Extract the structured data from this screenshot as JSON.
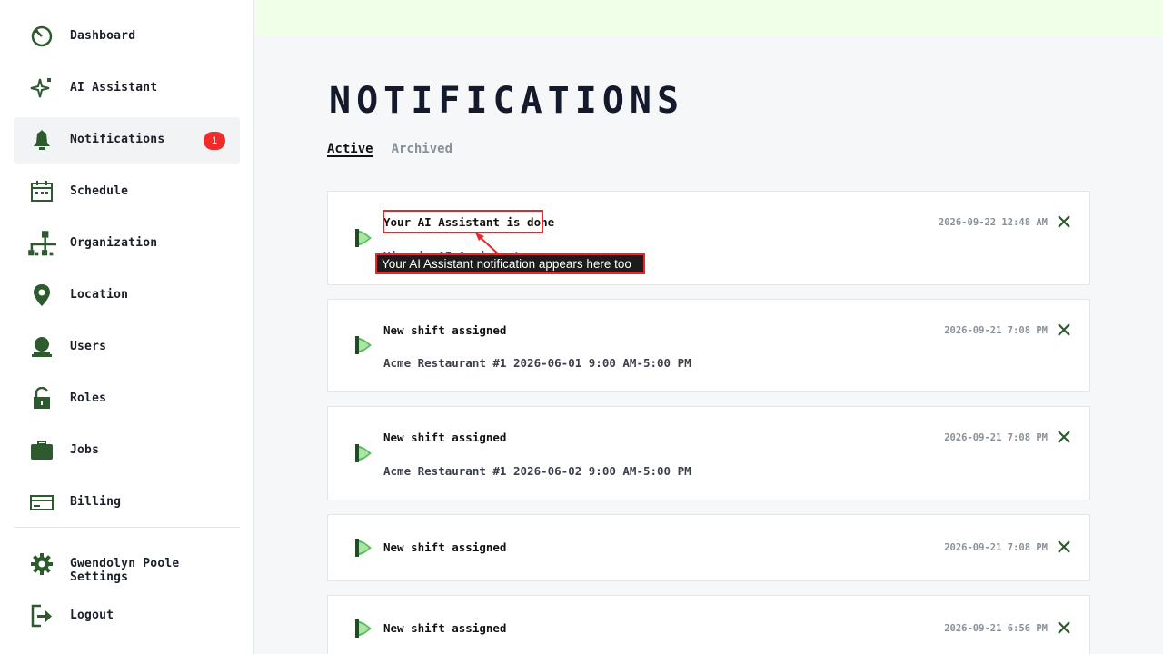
{
  "sidebar": {
    "items": [
      {
        "label": "Dashboard",
        "icon": "dashboard-gauge-icon"
      },
      {
        "label": "AI Assistant",
        "icon": "sparkle-icon"
      },
      {
        "label": "Notifications",
        "icon": "bell-icon",
        "badge": "1",
        "active": true
      },
      {
        "label": "Schedule",
        "icon": "calendar-icon"
      },
      {
        "label": "Organization",
        "icon": "org-chart-icon"
      },
      {
        "label": "Location",
        "icon": "map-pin-icon"
      },
      {
        "label": "Users",
        "icon": "user-icon"
      },
      {
        "label": "Roles",
        "icon": "unlock-icon"
      },
      {
        "label": "Jobs",
        "icon": "briefcase-icon"
      },
      {
        "label": "Billing",
        "icon": "credit-card-icon"
      },
      {
        "label": "Gwendolyn Poole Settings",
        "icon": "gear-icon"
      },
      {
        "label": "Logout",
        "icon": "logout-icon"
      }
    ]
  },
  "page": {
    "title": "NOTIFICATIONS",
    "tabs": [
      {
        "label": "Active",
        "active": true
      },
      {
        "label": "Archived",
        "active": false
      }
    ]
  },
  "notifications": [
    {
      "title": "Your AI Assistant is done",
      "subtitle": "View in AI Assistant",
      "time": "2026-09-22 12:48 AM"
    },
    {
      "title": "New shift assigned",
      "subtitle": "Acme Restaurant #1  2026-06-01  9:00 AM-5:00 PM",
      "time": "2026-09-21 7:08 PM"
    },
    {
      "title": "New shift assigned",
      "subtitle": "Acme Restaurant #1  2026-06-02  9:00 AM-5:00 PM",
      "time": "2026-09-21 7:08 PM"
    },
    {
      "title": "New shift assigned",
      "subtitle": "",
      "time": "2026-09-21 7:08 PM"
    },
    {
      "title": "New shift assigned",
      "subtitle": "",
      "time": "2026-09-21 6:56 PM"
    }
  ],
  "annotation": {
    "callout_text": "Your AI Assistant notification appears here too"
  },
  "colors": {
    "icon_green": "#2d5a2e",
    "badge_red": "#ef2b2b",
    "annotation_red": "#e8272b",
    "banner_green": "#efffe8"
  }
}
